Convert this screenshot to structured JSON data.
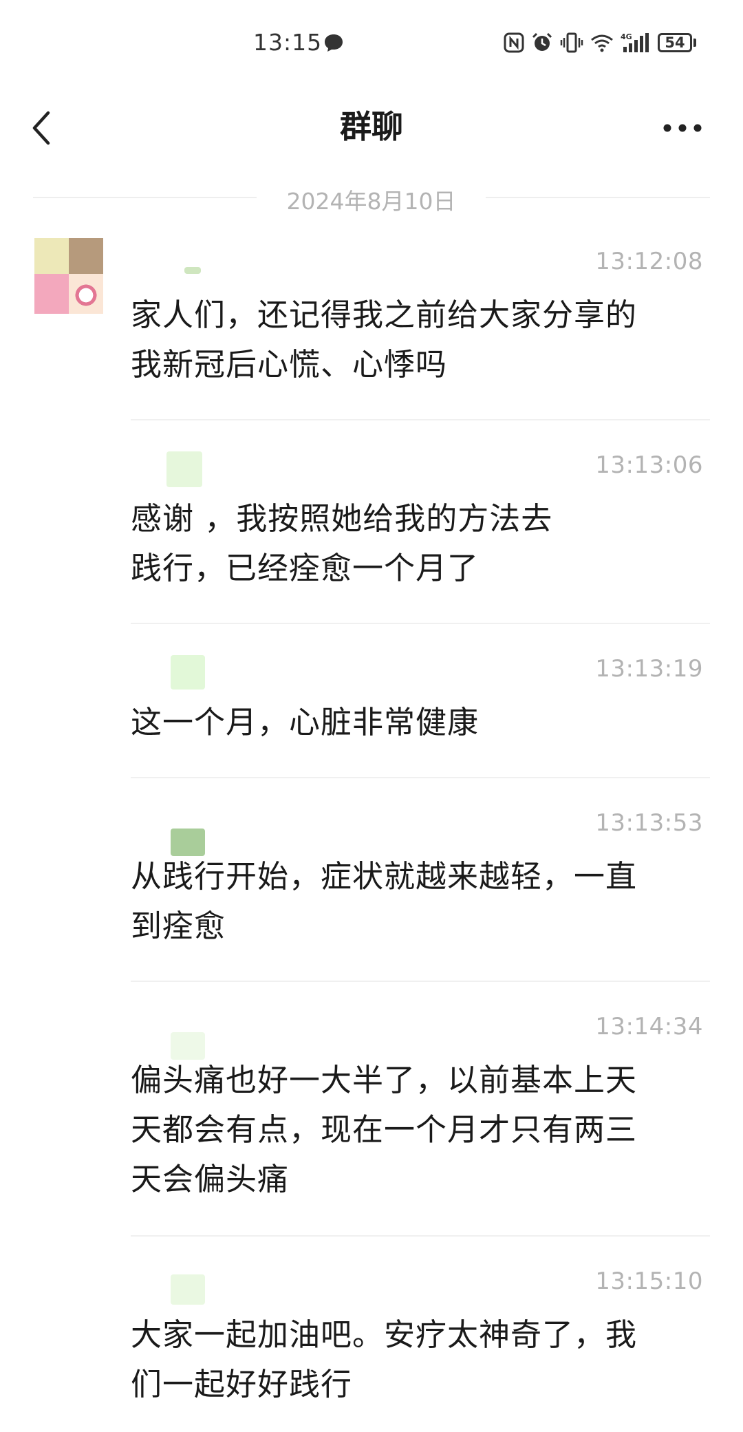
{
  "status_bar": {
    "time": "13:15",
    "battery": "54",
    "network": "4G"
  },
  "nav": {
    "title": "群聊"
  },
  "date_divider": "2024年8月10日",
  "messages": [
    {
      "time": "13:12:08",
      "text": "家人们，还记得我之前给大家分享的\n我新冠后心慌、心悸吗"
    },
    {
      "time": "13:13:06",
      "text": "感谢         ，我按照她给我的方法去\n践行，已经痊愈一个月了"
    },
    {
      "time": "13:13:19",
      "text": "这一个月，心脏非常健康"
    },
    {
      "time": "13:13:53",
      "text": "从践行开始，症状就越来越轻，一直\n到痊愈"
    },
    {
      "time": "13:14:34",
      "text": "偏头痛也好一大半了，以前基本上天\n天都会有点，现在一个月才只有两三\n天会偏头痛"
    },
    {
      "time": "13:15:10",
      "text": "大家一起加油吧。安疗太神奇了，我\n们一起好好践行"
    }
  ],
  "colors": {
    "timestamp": "#b3b3b3",
    "divider": "#f0f0f0",
    "text": "#1a1a1a"
  }
}
